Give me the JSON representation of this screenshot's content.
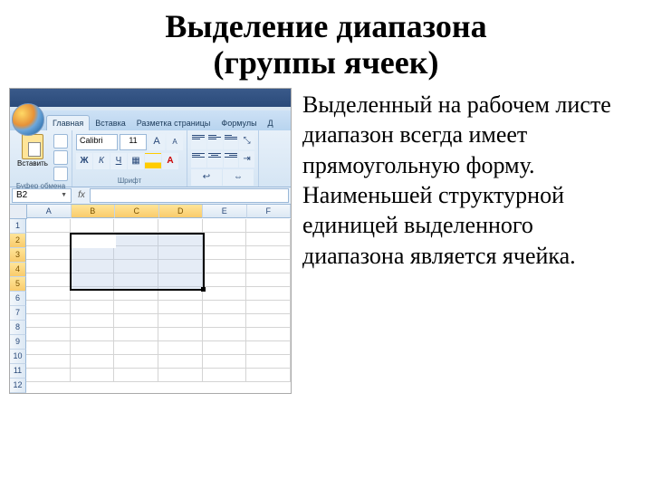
{
  "title_line1": "Выделение диапазона",
  "title_line2": "(группы ячеек)",
  "bodytext": "Выделенный на рабочем листе диапазон всегда имеет прямоугольную форму. Наименьшей структурной единицей выделенного диапазона является ячейка.",
  "excel": {
    "tabs": [
      "Главная",
      "Вставка",
      "Разметка страницы",
      "Формулы",
      "Д"
    ],
    "paste_label": "Вставить",
    "clipboard_label": "Буфер обмена",
    "font_label": "Шрифт",
    "font_name": "Calibri",
    "font_size": "11",
    "namebox": "B2",
    "fx": "fx",
    "columns": [
      "A",
      "B",
      "C",
      "D",
      "E",
      "F"
    ],
    "rows": [
      "1",
      "2",
      "3",
      "4",
      "5",
      "6",
      "7",
      "8",
      "9",
      "10",
      "11",
      "12"
    ],
    "bold": "Ж",
    "italic": "К",
    "underline": "Ч",
    "bigA": "A",
    "smallA": "A"
  }
}
